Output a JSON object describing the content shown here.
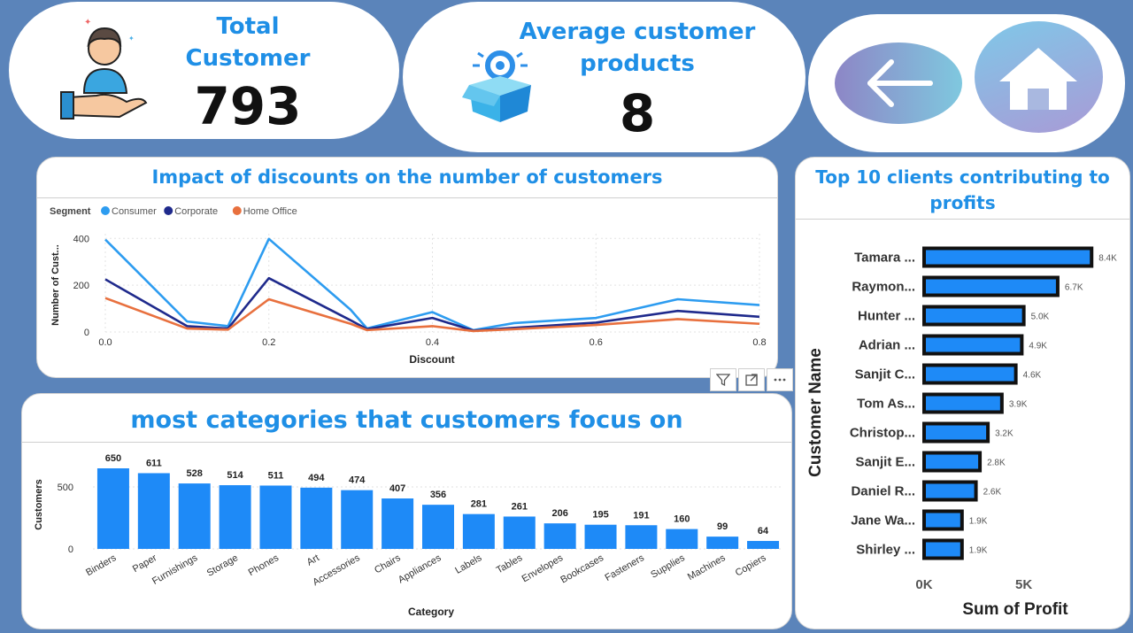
{
  "kpis": {
    "total_customer": {
      "title_line1": "Total",
      "title_line2": "Customer",
      "value": "793"
    },
    "avg_products": {
      "title_line1": "Average customer",
      "title_line2": "products",
      "value": "8"
    }
  },
  "nav": {
    "back_icon": "arrow-left-icon",
    "home_icon": "home-icon"
  },
  "line_chart": {
    "title": "Impact of discounts on the number of customers",
    "legend_title": "Segment",
    "xlabel": "Discount",
    "ylabel": "Number of Cust..."
  },
  "bar_chart": {
    "title": "most categories that customers focus on",
    "xlabel": "Category",
    "ylabel": "Customers"
  },
  "top_chart": {
    "title_line1": "Top 10 clients contributing to",
    "title_line2": "profits",
    "xlabel": "Sum of Profit",
    "ylabel": "Customer Name"
  },
  "colors": {
    "accent": "#1f8fe6",
    "bar": "#1e8af7",
    "consumer": "#2d9cf0",
    "corporate": "#1f2a8c",
    "home_office": "#e8703e",
    "background": "#5b84ba"
  },
  "chart_data": [
    {
      "type": "line",
      "title": "Impact of discounts on the number of customers",
      "xlabel": "Discount",
      "ylabel": "Number of Cust...",
      "x": [
        0.0,
        0.1,
        0.15,
        0.2,
        0.3,
        0.32,
        0.4,
        0.45,
        0.5,
        0.6,
        0.7,
        0.8
      ],
      "xticks": [
        "0.0",
        "0.2",
        "0.4",
        "0.6",
        "0.8"
      ],
      "yticks": [
        "0",
        "200",
        "400"
      ],
      "xlim": [
        0,
        0.8
      ],
      "ylim": [
        0,
        420
      ],
      "legend_position": "top-left",
      "grid": true,
      "series": [
        {
          "name": "Consumer",
          "values": [
            395,
            45,
            25,
            398,
            95,
            15,
            85,
            8,
            38,
            60,
            140,
            115
          ]
        },
        {
          "name": "Corporate",
          "values": [
            225,
            25,
            15,
            230,
            50,
            12,
            60,
            6,
            18,
            40,
            90,
            65
          ]
        },
        {
          "name": "Home Office",
          "values": [
            145,
            15,
            10,
            140,
            35,
            8,
            25,
            4,
            12,
            30,
            55,
            35
          ]
        }
      ]
    },
    {
      "type": "bar",
      "title": "most categories that customers focus on",
      "xlabel": "Category",
      "ylabel": "Customers",
      "categories": [
        "Binders",
        "Paper",
        "Furnishings",
        "Storage",
        "Phones",
        "Art",
        "Accessories",
        "Chairs",
        "Appliances",
        "Labels",
        "Tables",
        "Envelopes",
        "Bookcases",
        "Fasteners",
        "Supplies",
        "Machines",
        "Copiers"
      ],
      "values": [
        650,
        611,
        528,
        514,
        511,
        494,
        474,
        407,
        356,
        281,
        261,
        206,
        195,
        191,
        160,
        99,
        64
      ],
      "yticks": [
        "0",
        "500"
      ],
      "ylim": [
        0,
        700
      ]
    },
    {
      "type": "bar",
      "orientation": "horizontal",
      "title": "Top 10 clients contributing to profits",
      "xlabel": "Sum of Profit",
      "ylabel": "Customer Name",
      "categories": [
        "Tamara ...",
        "Raymon...",
        "Hunter ...",
        "Adrian ...",
        "Sanjit C...",
        "Tom As...",
        "Christop...",
        "Sanjit E...",
        "Daniel R...",
        "Jane Wa...",
        "Shirley ..."
      ],
      "values": [
        8.4,
        6.7,
        5.0,
        4.9,
        4.6,
        3.9,
        3.2,
        2.8,
        2.6,
        1.9,
        1.9
      ],
      "value_labels": [
        "8.4K",
        "6.7K",
        "5.0K",
        "4.9K",
        "4.6K",
        "3.9K",
        "3.2K",
        "2.8K",
        "2.6K",
        "1.9K",
        "1.9K"
      ],
      "xticks": [
        "0K",
        "5K"
      ],
      "xlim": [
        0,
        9.5
      ]
    }
  ]
}
